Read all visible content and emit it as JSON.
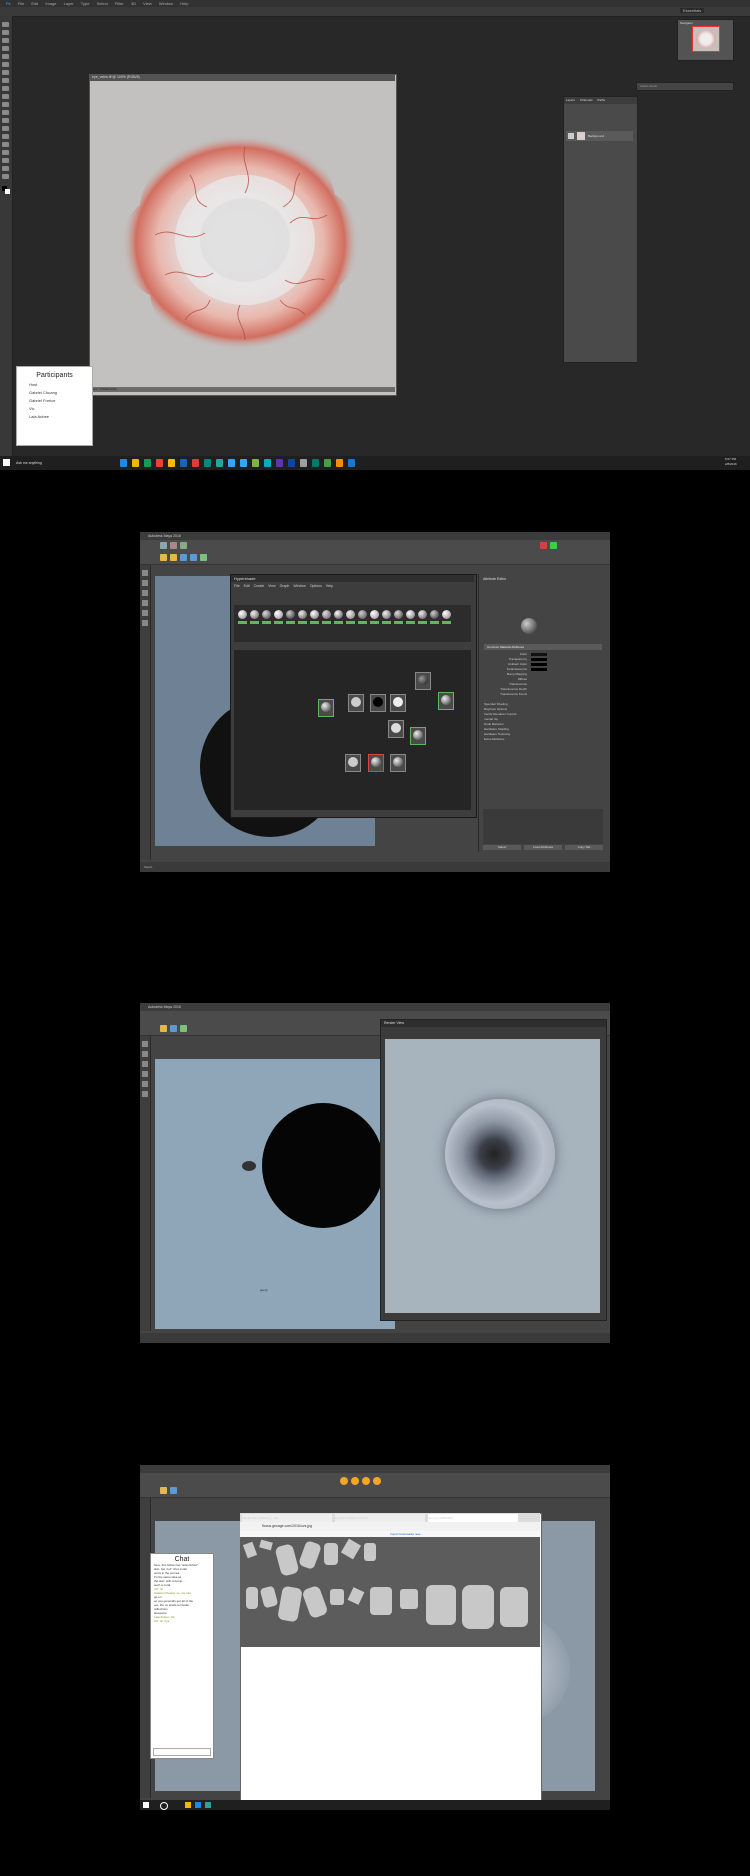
{
  "frame1": {
    "menu": [
      "File",
      "Edit",
      "Image",
      "Layer",
      "Type",
      "Select",
      "Filter",
      "3D",
      "View",
      "Window",
      "Help"
    ],
    "workspace_label": "Essentials",
    "doc_tab": "eye_veins.tif @ 100% (RGB/8)",
    "doc_status": "Doc: 3.00M/3.00M",
    "navigator_label": "Navigator",
    "search_placeholder": "Adobe Stock",
    "layers_tabs": [
      "Layers",
      "Channels",
      "Paths"
    ],
    "layer_name": "Background",
    "participants": {
      "title": "Participants",
      "people": [
        "Host",
        "Gabriel Chuang",
        "Gabriel Forrice",
        "Vic",
        "Lala Aubee"
      ]
    },
    "taskbar": {
      "search": "Ask me anything",
      "time": "5:07 PM",
      "date": "2/8/2016"
    },
    "colors": {
      "app_bg": "#282828",
      "panel": "#535353",
      "accent_red": "#c95a4c"
    }
  },
  "frame2": {
    "title": "Autodesk Maya 2016",
    "hypershade_title": "Hypershade",
    "hypershade_menu": [
      "File",
      "Edit",
      "Create",
      "View",
      "Graph",
      "Window",
      "Options",
      "Help"
    ],
    "attr_title": "Attribute Editor",
    "attr_section": "Common Material Attributes",
    "attr_labels": [
      "Color",
      "Transparency",
      "Ambient Color",
      "Incandescence",
      "Bump Mapping",
      "Diffuse",
      "Translucence",
      "Translucence Depth",
      "Translucence Focus"
    ],
    "attr_subsections": [
      "Specular Shading",
      "Raytrace Options",
      "Vector Renderer Control",
      "mental ray",
      "Node Behavior",
      "Hardware Shading",
      "Hardware Texturing",
      "Extra Attributes"
    ],
    "buttons": [
      "Select",
      "Load Attributes",
      "Copy Tab"
    ],
    "status": "Select"
  },
  "frame3": {
    "title": "Autodesk Maya 2016",
    "render_title": "Render View",
    "camera_label": "persp"
  },
  "frame4": {
    "chat": {
      "title": "Chat",
      "lines": [
        "here, this fellow has \"astonished\"",
        "skin, but 'cuz\" shut small",
        "veins in the cornea",
        "it's the same idea as",
        "the skin, with a bump...",
        "such a coral",
        "Vic: ok",
        "Gabriel Chuang: so, we can",
        "go on",
        "so you generally get all of the",
        "out, the uv shells for better",
        "reflections",
        "awesome",
        "Lala Aubee: Ok",
        "Vic: ok, bye"
      ]
    },
    "browser": {
      "tabs": [
        "Mental Ray Scattering - Ma...",
        "Eyeball Creation Tutorial...",
        "uvs.jpg (1280x697)"
      ],
      "url": "flocus.gecage.com/2016/uvs.jpg",
      "bookmarks": "Import bookmarks now..."
    }
  }
}
